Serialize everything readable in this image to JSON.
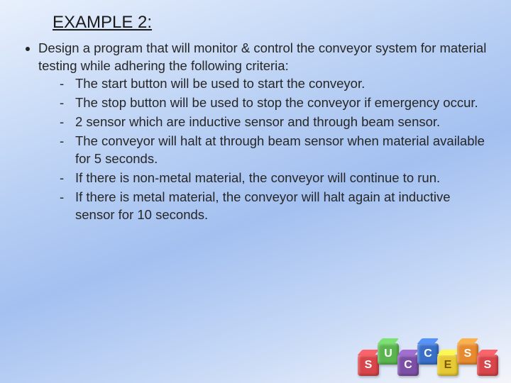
{
  "title": "EXAMPLE 2:",
  "intro": "Design a program that will monitor & control the conveyor system for material testing while adhering the following criteria:",
  "criteria": [
    "The start button will be used to start the conveyor.",
    "The stop button will be used to stop the conveyor if emergency occur.",
    "2 sensor which are inductive sensor and through beam sensor.",
    "The conveyor will halt at through beam sensor when material available for 5 seconds.",
    "If there is non-metal material, the conveyor will continue to run.",
    "If there is metal material, the conveyor will halt again at inductive sensor for 10 seconds."
  ],
  "blocks": {
    "letters": [
      "S",
      "U",
      "C",
      "C",
      "E",
      "S",
      "S"
    ]
  }
}
